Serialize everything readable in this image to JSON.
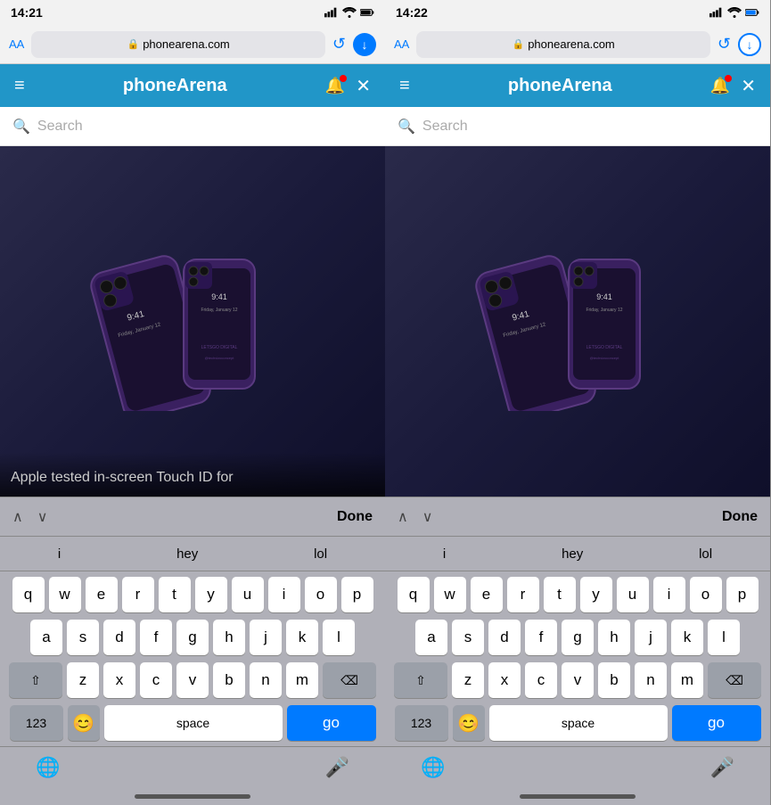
{
  "left_phone": {
    "status_bar": {
      "time": "14:21",
      "signal": "●●●",
      "wifi": "WiFi",
      "battery": "Battery"
    },
    "browser": {
      "aa_label": "AA",
      "url": "phonearena.com",
      "lock_icon": "🔒",
      "refresh_label": "↺",
      "download_label": "↓"
    },
    "nav": {
      "hamburger": "≡",
      "title": "phoneArena",
      "bell": "🔔",
      "close": "✕"
    },
    "search": {
      "placeholder": "Search"
    },
    "article": {
      "title": "Apple tested in-screen Touch ID for"
    },
    "toolbar": {
      "arrow_up": "∧",
      "arrow_down": "∨",
      "done": "Done"
    },
    "autocomplete": {
      "items": [
        "i",
        "hey",
        "lol"
      ]
    },
    "keyboard_rows": [
      [
        "q",
        "w",
        "e",
        "r",
        "t",
        "y",
        "u",
        "i",
        "o",
        "p"
      ],
      [
        "a",
        "s",
        "d",
        "f",
        "g",
        "h",
        "j",
        "k",
        "l"
      ],
      [
        "shift",
        "z",
        "x",
        "c",
        "v",
        "b",
        "n",
        "m",
        "del"
      ],
      [
        "123",
        "emoji",
        "space",
        "go"
      ]
    ],
    "bottom": {
      "globe": "🌐",
      "mic": "🎤"
    }
  },
  "right_phone": {
    "status_bar": {
      "time": "14:22",
      "signal": "●●●",
      "wifi": "WiFi",
      "battery": "Battery"
    },
    "browser": {
      "aa_label": "AA",
      "url": "phonearena.com",
      "lock_icon": "🔒",
      "refresh_label": "↺",
      "download_label": "↓"
    },
    "nav": {
      "hamburger": "≡",
      "title": "phoneArena",
      "bell": "🔔",
      "close": "✕"
    },
    "search": {
      "placeholder": "Search"
    },
    "toolbar": {
      "arrow_up": "∧",
      "arrow_down": "∨",
      "done": "Done"
    },
    "autocomplete": {
      "items": [
        "i",
        "hey",
        "lol"
      ]
    },
    "keyboard_rows": [
      [
        "q",
        "w",
        "e",
        "r",
        "t",
        "y",
        "u",
        "i",
        "o",
        "p"
      ],
      [
        "a",
        "s",
        "d",
        "f",
        "g",
        "h",
        "j",
        "k",
        "l"
      ],
      [
        "shift",
        "z",
        "x",
        "c",
        "v",
        "b",
        "n",
        "m",
        "del"
      ],
      [
        "123",
        "emoji",
        "space",
        "go"
      ]
    ],
    "bottom": {
      "globe": "🌐",
      "mic": "🎤"
    }
  },
  "colors": {
    "nav_bg": "#2196c8",
    "key_bg": "#ffffff",
    "key_dark_bg": "#9ba0a9",
    "go_bg": "#007aff",
    "keyboard_bg": "#b0b0b8"
  }
}
